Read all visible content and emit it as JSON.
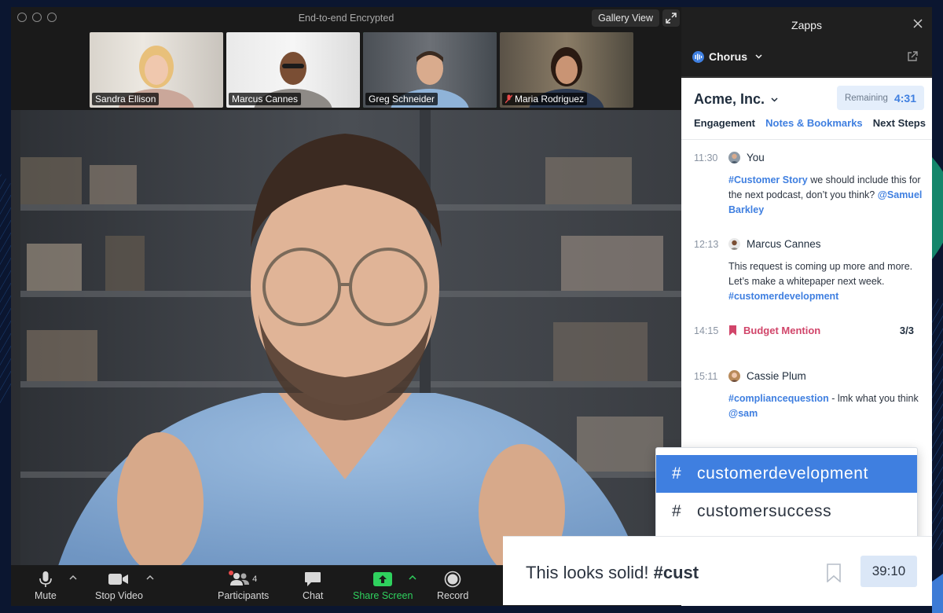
{
  "window": {
    "title": "End-to-end Encrypted",
    "gallery_view_label": "Gallery View"
  },
  "participants": [
    {
      "name": "Sandra Ellison",
      "muted": false,
      "active": false
    },
    {
      "name": "Marcus Cannes",
      "muted": false,
      "active": false
    },
    {
      "name": "Greg Schneider",
      "muted": false,
      "active": true
    },
    {
      "name": "Maria Rodriguez",
      "muted": true,
      "active": false
    }
  ],
  "toolbar": {
    "mute_label": "Mute",
    "stop_video_label": "Stop Video",
    "participants_label": "Participants",
    "participants_count": "4",
    "chat_label": "Chat",
    "share_screen_label": "Share Screen",
    "record_label": "Record"
  },
  "zapps": {
    "title": "Zapps",
    "app_name": "Chorus",
    "company": "Acme, Inc.",
    "remaining_label": "Remaining",
    "remaining_value": "4:31",
    "tabs": [
      {
        "label": "Engagement",
        "selected": false
      },
      {
        "label": "Notes & Bookmarks",
        "selected": true
      },
      {
        "label": "Next Steps",
        "selected": false
      }
    ],
    "notes": [
      {
        "time": "11:30",
        "author": "You",
        "tag": "#Customer Story",
        "text": " we should include this for the next podcast, don’t you think? ",
        "mention": "@Samuel Barkley"
      },
      {
        "time": "12:13",
        "author": "Marcus Cannes",
        "text": "This request is coming up more and more. Let’s make a whitepaper next week. ",
        "tag": "#customerdevelopment"
      },
      {
        "time": "14:15",
        "title": "Budget Mention",
        "count": "3/3"
      },
      {
        "time": "15:11",
        "author": "Cassie Plum",
        "tag": "#compliancequestion",
        "text": " - lmk what you think  ",
        "mention": "@sam"
      }
    ]
  },
  "autocomplete": {
    "items": [
      {
        "label": "customerdevelopment",
        "selected": true
      },
      {
        "label": "customersuccess",
        "selected": false
      }
    ]
  },
  "composer": {
    "text": "This looks solid! ",
    "tag_partial": "#cust",
    "timestamp": "39:10"
  },
  "colors": {
    "accent": "#3f7fe0",
    "active_speaker": "#2fd15e",
    "bookmark": "#d1456a"
  }
}
